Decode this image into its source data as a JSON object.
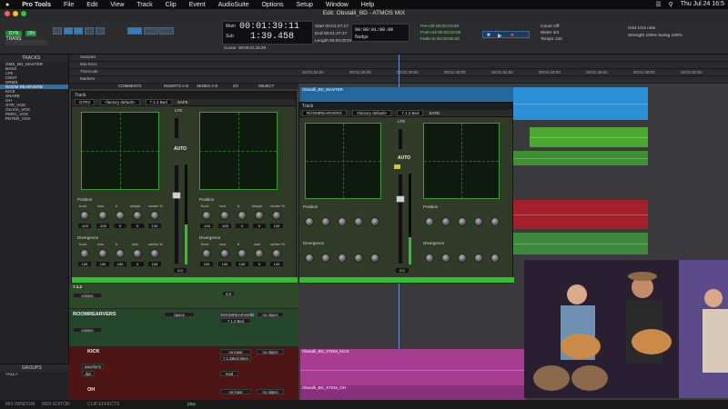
{
  "menubar": {
    "apple": "",
    "app": "Pro Tools",
    "items": [
      "File",
      "Edit",
      "View",
      "Track",
      "Clip",
      "Event",
      "AudioSuite",
      "Options",
      "Setup",
      "Window",
      "Help"
    ],
    "clock": "Thu Jul 24  16:5"
  },
  "window": {
    "title": "Edit: Obstalli_BD - ATMOS MIX"
  },
  "toolbar": {
    "main_counter": "00:01:39:11",
    "sub_counter": "1:39.458",
    "main_label": "Main",
    "sub_label": "Sub",
    "cursor_label": "Cursor",
    "cursor_value": "00:00:01:15:20",
    "start_label": "Start",
    "end_label": "End",
    "length_label": "Length",
    "start_value": "00:01:27:17",
    "end_value": "00:01:27:17",
    "length_value": "00:00:00:00",
    "nudge_label": "Nudge",
    "nudge_value": "00:00:01:00.00",
    "preroll_label": "Pre-roll",
    "postroll_label": "Post-roll",
    "fadein_label": "Fade-in",
    "preroll_value": "00:00:03:00",
    "postroll_value": "00:00:03:00",
    "fadein_value": "00:00:00:00",
    "grid_label": "Grid",
    "grid_value": "1/16 note",
    "nudge2_label": "Nudge",
    "strength_label": "Strength",
    "swing_label": "Swing",
    "strength_value": "100%",
    "swing_value": "100%",
    "rate_label": "Count Off",
    "meter_label": "Meter",
    "tempo_label": "Tempo",
    "meter_value": "4/4",
    "tempo_value": "120",
    "dyn_transport": "DYN TRANS",
    "cp_label": "ON"
  },
  "tracklist": {
    "header": "TRACKS",
    "items": [
      "OMS_BD_MASTER",
      "BASS",
      "LFE",
      "CENT",
      "DRMS",
      "ROOM REARVERB",
      "KICK",
      "SNARE",
      "OH",
      "GTR_VOX",
      "OLIVIA_VOX",
      "PERC_VOX",
      "PETER_VOX"
    ],
    "selected_index": 5,
    "groups_header": "GROUPS",
    "groups_item": "<ALL>"
  },
  "rulers": {
    "rows": [
      "Samples",
      "Min:Secs",
      "Timecode",
      "Markers"
    ],
    "ticks": [
      "00:01:34:00",
      "00:01:36:00",
      "00:01:38:00",
      "00:01:40:00",
      "00:01:42:00",
      "00:01:44:00",
      "00:01:46:00",
      "00:01:48:00",
      "00:01:50:00"
    ]
  },
  "edit_header": {
    "cols": [
      "COMMENTS",
      "INSERTS A-E",
      "SENDS A-E",
      "I/O",
      "OBJECT"
    ]
  },
  "plugin1": {
    "title": "Track",
    "track": "GTR3",
    "preset": "<factory default>",
    "insert": "7.1.2 Bed",
    "btns": [
      "SAFE"
    ]
  },
  "plugin2": {
    "title": "Track",
    "track": "ROOMREARVERS",
    "preset": "<factory default>",
    "insert": "7.1.2 Bed",
    "btns": [
      "SAFE"
    ]
  },
  "panner": {
    "lfe": "LFE",
    "auto": "AUTO",
    "position": "Position",
    "divergence": "Divergence",
    "pos_knobs": [
      "front",
      "rear",
      "fr",
      "height",
      "center %"
    ],
    "div_knobs": [
      "front",
      "rear",
      "fr",
      "size",
      "center %"
    ],
    "pos_vals": [
      "-100",
      "-100",
      "0",
      "0",
      "100"
    ],
    "div_vals": [
      "100",
      "100",
      "100",
      "0",
      "100"
    ],
    "fader_val": "0.0"
  },
  "mixrows": {
    "row1_label": "7.1.2",
    "volume": "volume",
    "room": "ROOMREARVERS",
    "space": "Space",
    "rrv": "ROOMREARVERB",
    "bus": "7.1.2 Bed",
    "no_object": "no object",
    "kick": "KICK",
    "oh": "OH",
    "kick_input": "no input",
    "kick_bus": "7.1.2Bed Stem",
    "read": "read",
    "vol_val": "0.0",
    "dyn": "dyn",
    "waveform": "waveform",
    "dB": "0 dB"
  },
  "clips": {
    "master": "Obstalli_BD_MASTER",
    "kick": "Obstalli_BD_STEM_KICK",
    "oh": "Obstalli_BD_STEM_OH",
    "play": "play"
  },
  "bottom": {
    "left": "MIX WINDOW",
    "mid": "MIDI EDITOR",
    "right": "CLIP EFFECTS"
  },
  "colors": {
    "green": "#2fbf2f",
    "blue_clip": "#2a8ad0",
    "red_track": "#8c1a1a",
    "pink_clip": "#c03ca0",
    "green_clip": "#5ab03a"
  }
}
